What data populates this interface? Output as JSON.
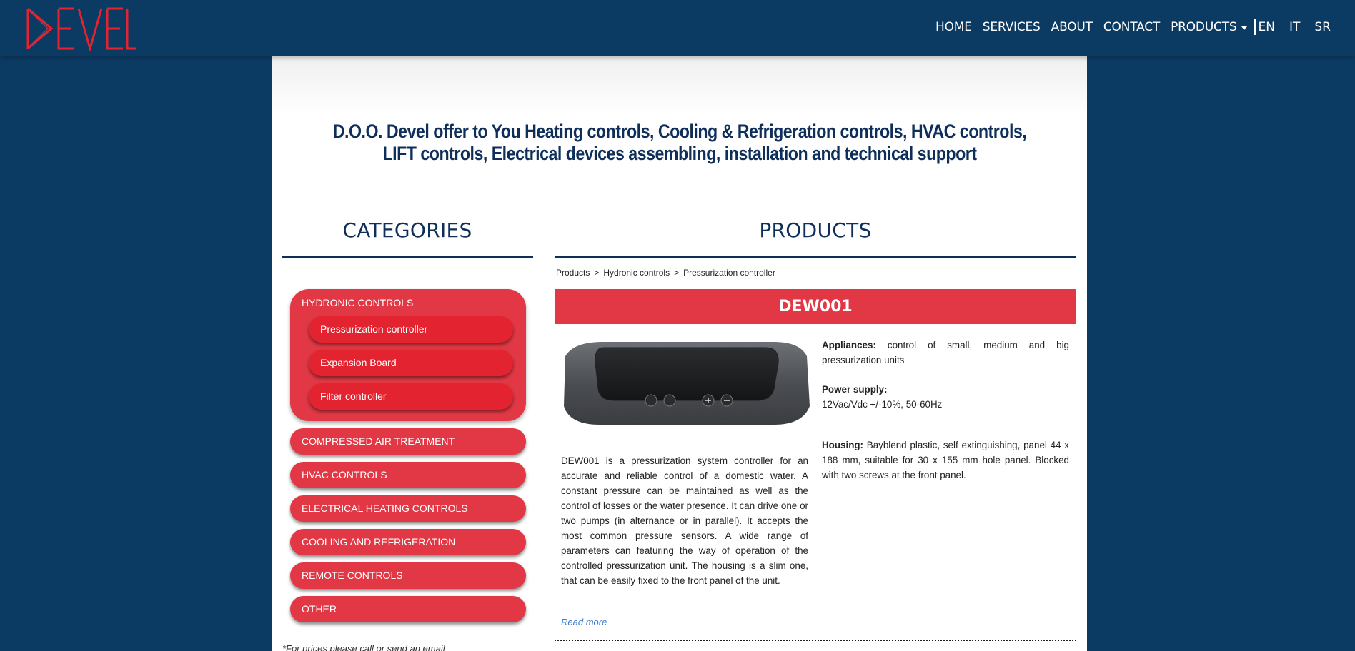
{
  "nav": {
    "logo_text": "DEVEL",
    "links": [
      "HOME",
      "SERVICES",
      "ABOUT",
      "CONTACT"
    ],
    "products_label": "PRODUCTS",
    "languages": [
      "EN",
      "IT",
      "SR"
    ]
  },
  "headline": {
    "strong": "D.O.O. Devel",
    "rest": " offer to You Heating controls, Cooling & Refrigeration controls, HVAC controls, LIFT controls, Electrical devices assembling, installation and technical support"
  },
  "categories": {
    "heading": "CATEGORIES",
    "group": {
      "title": "HYDRONIC CONTROLS",
      "items": [
        "Pressurization controller",
        "Expansion Board",
        "Filter controller"
      ]
    },
    "items": [
      "COMPRESSED AIR TREATMENT",
      "HVAC CONTROLS",
      "ELECTRICAL HEATING CONTROLS",
      "COOLING AND REFRIGERATION",
      "REMOTE CONTROLS",
      "OTHER"
    ],
    "footnote": "*For prices please call or send an email"
  },
  "products": {
    "heading": "PRODUCTS",
    "breadcrumb": [
      "Products",
      "Hydronic controls",
      "Pressurization controller"
    ],
    "breadcrumb_sep": ">",
    "product_name": "DEW001",
    "description": "DEW001 is a pressurization system controller for an accurate and reliable control of a domestic water. A constant pressure can be maintained as well as the control of losses or the water presence. It can drive one or two pumps (in alternance or in parallel). It accepts the most common pressure sensors. A wide range of parameters can featuring the way of operation of the controlled pressurization unit. The housing is a slim one, that can be easily fixed to the front panel of the unit.",
    "read_more": "Read more",
    "specs": {
      "appliances_label": "Appliances:",
      "appliances_value": " control of small, medium and big pressurization units",
      "power_label": "Power supply:",
      "power_value": "12Vac/Vdc +/-10%, 50-60Hz",
      "housing_label": "Housing:",
      "housing_value": " Bayblend plastic, self extinguishing, panel 44 x 188 mm, suitable for 30 x 155 mm hole panel. Blocked with two screws at the front panel."
    }
  },
  "colors": {
    "navy": "#0b3b63",
    "red": "#e23845",
    "heading": "#0e2f5a"
  }
}
